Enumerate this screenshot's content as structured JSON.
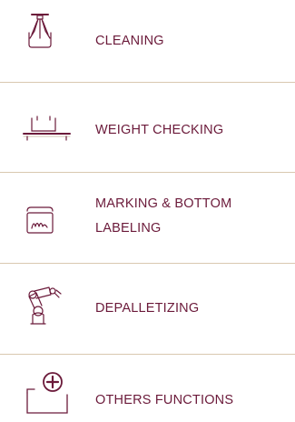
{
  "colors": {
    "text": "#6b1a3a",
    "icon_stroke": "#6b1a3a",
    "divider": "#d9c8b0"
  },
  "functions": [
    {
      "label": "CLEANING",
      "icon": "cleaning-nozzle-icon"
    },
    {
      "label": "WEIGHT CHECKING",
      "icon": "weighing-scale-icon"
    },
    {
      "label_line1": "MARKING & BOTTOM",
      "label_line2": "LABELING",
      "icon": "marking-label-icon"
    },
    {
      "label": "DEPALLETIZING",
      "icon": "robot-arm-icon"
    },
    {
      "label": "OTHERS FUNCTIONS",
      "icon": "plus-circle-icon"
    }
  ]
}
